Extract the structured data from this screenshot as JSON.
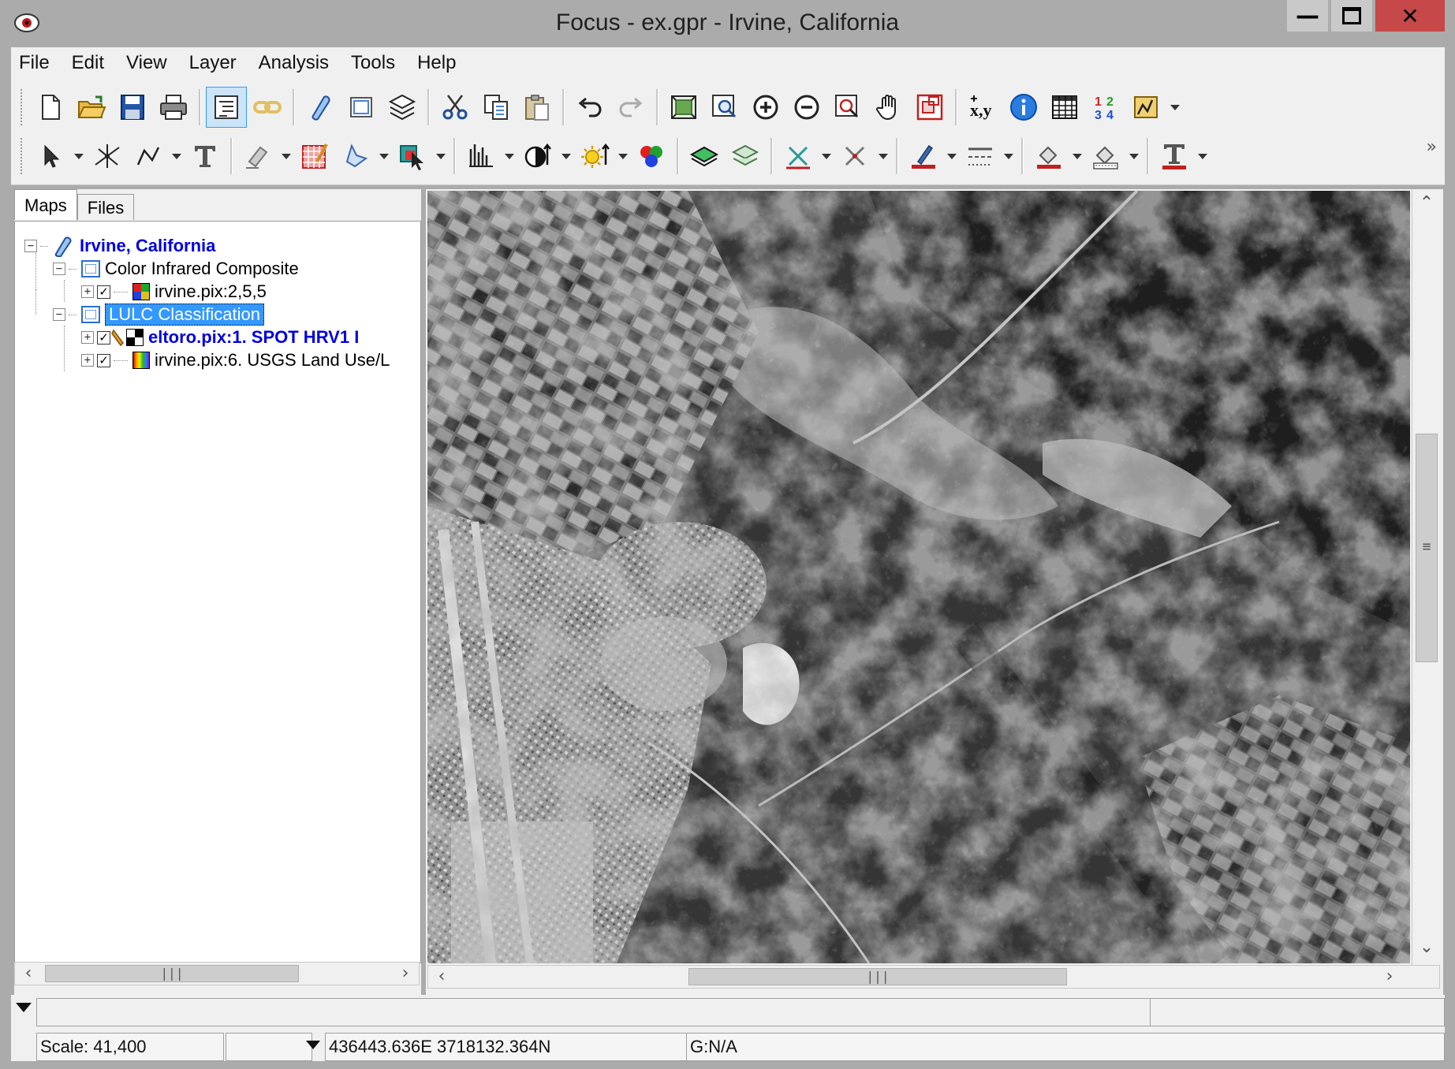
{
  "window": {
    "title": "Focus - ex.gpr - Irvine, California"
  },
  "menu": [
    "File",
    "Edit",
    "View",
    "Layer",
    "Analysis",
    "Tools",
    "Help"
  ],
  "left_panel": {
    "tabs": [
      "Maps",
      "Files"
    ],
    "tree": {
      "map_name": "Irvine, California",
      "areas": [
        {
          "name": "Color Infrared Composite",
          "layers": [
            {
              "name": "irvine.pix:2,5,5",
              "checked": true
            }
          ]
        },
        {
          "name": "LULC Classification",
          "layers": [
            {
              "name": "eltoro.pix:1. SPOT HRV1 I",
              "checked": true
            },
            {
              "name": "irvine.pix:6. USGS Land Use/L",
              "checked": true
            }
          ]
        }
      ]
    }
  },
  "status": {
    "scale": "Scale: 41,400",
    "coordinates": "436443.636E 3718132.364N",
    "grey_value": "G:N/A"
  }
}
